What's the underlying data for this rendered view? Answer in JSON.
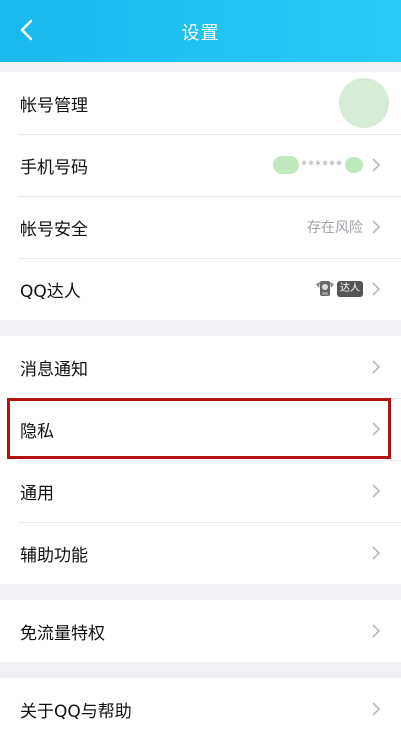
{
  "header": {
    "title": "设置"
  },
  "group1": {
    "account": {
      "label": "帐号管理"
    },
    "phone": {
      "label": "手机号码",
      "masked": "******"
    },
    "security": {
      "label": "帐号安全",
      "status": "存在风险"
    },
    "qq_talent": {
      "label": "QQ达人",
      "badge": "达人"
    }
  },
  "group2": {
    "notifications": {
      "label": "消息通知"
    },
    "privacy": {
      "label": "隐私"
    },
    "general": {
      "label": "通用"
    },
    "accessibility": {
      "label": "辅助功能"
    }
  },
  "group3": {
    "free_data": {
      "label": "免流量特权"
    }
  },
  "group4": {
    "about": {
      "label": "关于QQ与帮助"
    }
  },
  "colors": {
    "header": "#1cbef0",
    "highlight": "#b3130f"
  }
}
